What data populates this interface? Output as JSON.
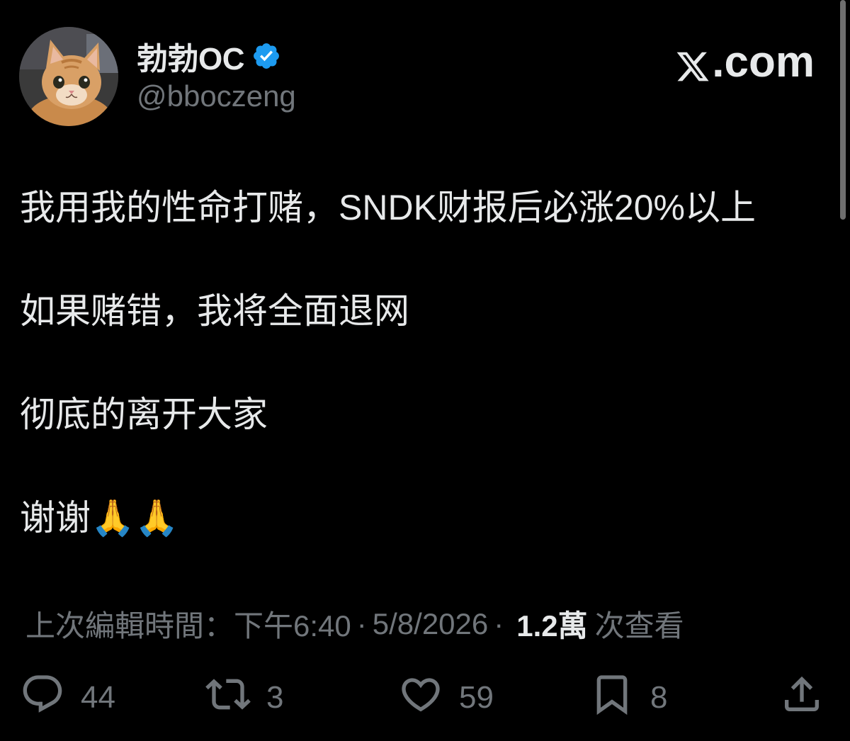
{
  "author": {
    "display_name": "勃勃OC",
    "handle": "@bboczeng",
    "verified": true,
    "avatar_icon": "cat-avatar"
  },
  "brand": {
    "label": ".com",
    "icon": "x-logo-icon"
  },
  "tweet": {
    "lines": [
      "我用我的性命打赌，SNDK财报后必涨20%以上",
      "如果赌错，我将全面退网",
      "彻底的离开大家",
      "谢谢🙏🙏"
    ]
  },
  "meta": {
    "edited_label": "上次編輯時間：",
    "time": "下午6:40",
    "date": "5/8/2026",
    "views_count": "1.2萬",
    "views_label": "次查看",
    "separator": "·"
  },
  "actions": {
    "reply": {
      "icon": "reply-icon",
      "count": "44"
    },
    "repost": {
      "icon": "repost-icon",
      "count": "3"
    },
    "like": {
      "icon": "heart-icon",
      "count": "59"
    },
    "bookmark": {
      "icon": "bookmark-icon",
      "count": "8"
    },
    "share": {
      "icon": "share-icon"
    }
  },
  "colors": {
    "background": "#000000",
    "text_primary": "#e7e9ea",
    "text_secondary": "#71767b",
    "verified_blue": "#1d9bf0"
  }
}
